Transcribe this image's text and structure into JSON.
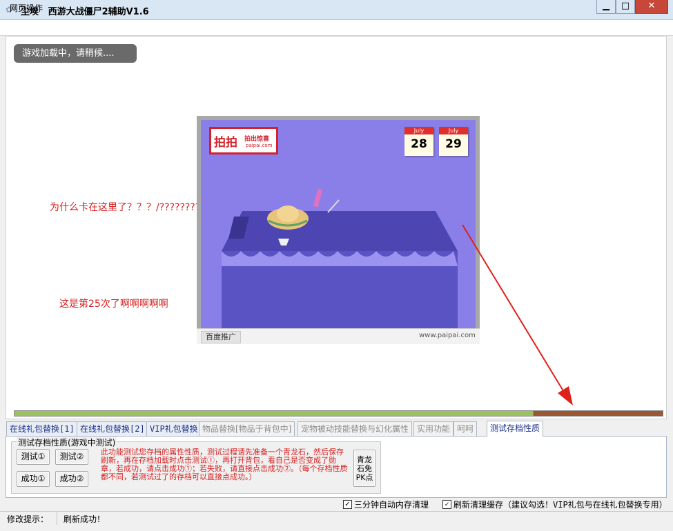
{
  "window": {
    "icon": "app-icon",
    "title": "尘埃   西游大战僵尸2辅助V1.6",
    "min_label": "▁",
    "max_label": "□",
    "close_label": "✕"
  },
  "menu": {
    "items": [
      {
        "label": "网页操作"
      }
    ]
  },
  "webview": {
    "loading_text": "游戏加载中，请稍候....",
    "annotations": [
      "为什么卡在这里了？？？/?????????",
      "这是第25次了啊啊啊啊啊"
    ],
    "arrow_color": "#e0201a",
    "ad": {
      "logo_main": "拍拍",
      "logo_tagline": "拍出惊喜",
      "logo_domain": "paipai.com",
      "calendars": [
        {
          "month": "July",
          "day": "28"
        },
        {
          "month": "July",
          "day": "29"
        }
      ],
      "baidu_tag": "百度推广",
      "url": "www.paipai.com",
      "background": "#8a7fe8"
    }
  },
  "progress": {
    "fraction": 0.8,
    "fill_color": "#9bc160",
    "track_color": "#9b5731"
  },
  "tabs": [
    {
      "label": "在线礼包替换[1]",
      "state": "enabled"
    },
    {
      "label": "在线礼包替换[2]",
      "state": "enabled"
    },
    {
      "label": "VIP礼包替换",
      "state": "enabled"
    },
    {
      "label": "物品替换[物品于背包中]",
      "state": "disabled"
    },
    {
      "label": "宠物被动技能替换与幻化属性",
      "state": "disabled"
    },
    {
      "label": "实用功能",
      "state": "disabled"
    },
    {
      "label": "呵呵",
      "state": "disabled"
    },
    {
      "label": "测试存档性质",
      "state": "active"
    }
  ],
  "panel": {
    "group_title": "测试存档性质(游戏中测试)",
    "buttons": {
      "test1": "测试①",
      "test2": "测试②",
      "success1": "成功①",
      "success2": "成功②",
      "qinglong": "青龙\n石免\nPK点"
    },
    "instructions": "此功能测试您存档的属性性质，测试过程请先准备一个青龙石，然后保存刷新，再在存档加载时点击测试①，再打开背包，看自己是否变成了勋章，若成功，请点击成功①；若失败，请直接点击成功②。（每个存档性质都不同，若测试过了的存档可以直接点成功。）"
  },
  "options": {
    "auto_clean": {
      "label": "三分钟自动内存清理",
      "checked": true
    },
    "refresh_clean": {
      "label": "刷新清理缓存（建议勾选！VIP礼包与在线礼包替换专用）",
      "checked": true
    }
  },
  "status": {
    "label": "修改提示：",
    "value": "刷新成功！"
  }
}
